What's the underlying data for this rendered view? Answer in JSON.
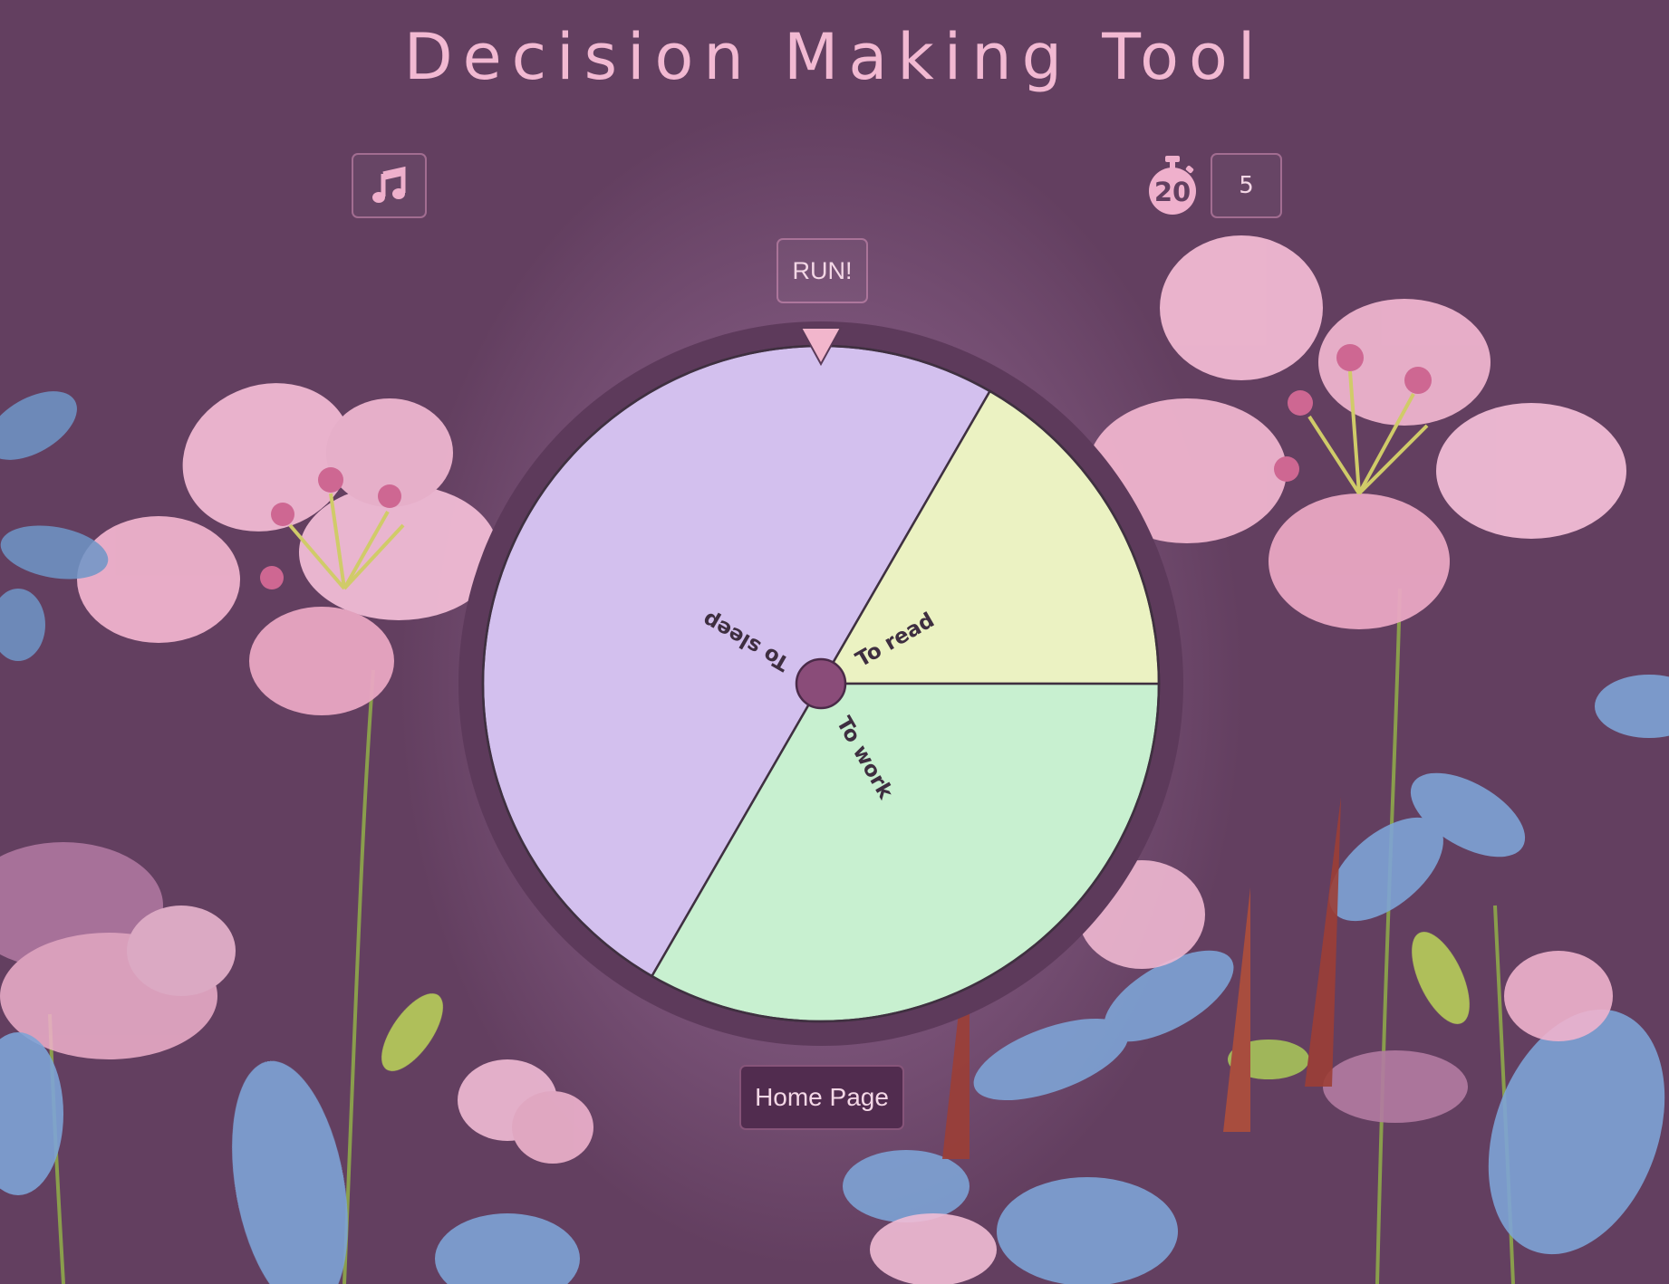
{
  "page": {
    "title": "Decision Making Tool"
  },
  "controls": {
    "music_icon": "music-note-icon",
    "timer_icon": "stopwatch-icon",
    "timer_icon_text": "20",
    "timer_value": "5",
    "run_label": "RUN!",
    "home_label": "Home Page"
  },
  "wheel": {
    "pointer_color": "#f2b6cc",
    "hub_color": "#8a4c79",
    "segments": [
      {
        "label": "To sleep",
        "color": "#d3c0ee",
        "share": 0.5
      },
      {
        "label": "To read",
        "color": "#ebf2c2",
        "share": 0.1667
      },
      {
        "label": "To work",
        "color": "#c8f0d0",
        "share": 0.3333
      }
    ]
  },
  "colors": {
    "background": "#633f60",
    "accent_pink": "#f2b9d2"
  }
}
